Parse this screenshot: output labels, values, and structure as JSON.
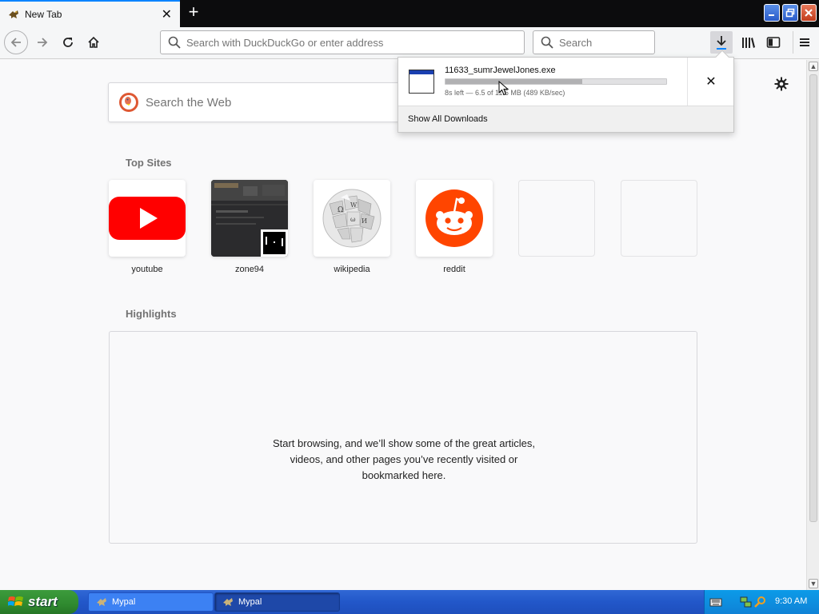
{
  "tab": {
    "title": "New Tab"
  },
  "toolbar": {
    "url_placeholder": "Search with DuckDuckGo or enter address",
    "search_placeholder": "Search"
  },
  "newtab": {
    "websearch_placeholder": "Search the Web",
    "topsites_title": "Top Sites",
    "topsites": [
      {
        "label": "youtube"
      },
      {
        "label": "zone94"
      },
      {
        "label": "wikipedia"
      },
      {
        "label": "reddit"
      }
    ],
    "highlights_title": "Highlights",
    "highlights_message": "Start browsing, and we’ll show some of the great articles, videos, and other pages you’ve recently visited or bookmarked here."
  },
  "downloads": {
    "filename": "11633_sumrJewelJones.exe",
    "status": "8s left — 6.5 of 11.5 MB (489 KB/sec)",
    "progress": 0.62,
    "show_all": "Show All Downloads"
  },
  "taskbar": {
    "start_label": "start",
    "items": [
      {
        "label": "Mypal"
      },
      {
        "label": "Mypal"
      }
    ],
    "clock": "9:30 AM"
  },
  "colors": {
    "accent": "#0a84ff",
    "youtube_red": "#ff0000",
    "reddit_orange": "#ff4500",
    "xp_blue": "#2257c9",
    "xp_green": "#2f8a2f"
  }
}
